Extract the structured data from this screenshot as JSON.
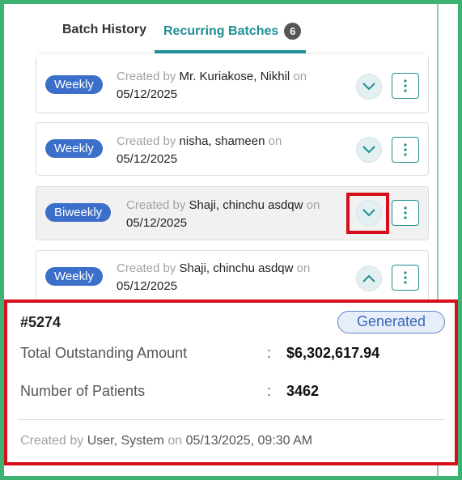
{
  "tabs": {
    "history_label": "Batch History",
    "recurring_label": "Recurring Batches",
    "recurring_count": "6"
  },
  "batches": [
    {
      "frequency": "Weekly",
      "created_by_prefix": "Created by",
      "creator": "Mr. Kuriakose, Nikhil",
      "on_text": "on",
      "date": "05/12/2025",
      "chevron_icon": "chevron-down-icon"
    },
    {
      "frequency": "Weekly",
      "created_by_prefix": "Created by",
      "creator": "nisha, shameen",
      "on_text": "on",
      "date": "05/12/2025",
      "chevron_icon": "chevron-down-icon"
    },
    {
      "frequency": "Biweekly",
      "created_by_prefix": "Created by",
      "creator": "Shaji, chinchu asdqw",
      "on_text": "on",
      "date": "05/12/2025",
      "chevron_icon": "chevron-down-icon"
    },
    {
      "frequency": "Weekly",
      "created_by_prefix": "Created by",
      "creator": "Shaji, chinchu asdqw",
      "on_text": "on",
      "date": "05/12/2025",
      "chevron_icon": "chevron-up-icon"
    }
  ],
  "detail": {
    "id": "#5274",
    "status": "Generated",
    "outstanding_label": "Total Outstanding Amount",
    "outstanding_value": "$6,302,617.94",
    "patients_label": "Number of Patients",
    "patients_value": "3462",
    "separator": ":",
    "created_by_prefix": "Created by",
    "creator": "User, System",
    "on_text": "on",
    "created_at": "05/13/2025, 09:30 AM"
  },
  "colors": {
    "frame": "#3cb371",
    "accent_teal": "#1e8f93",
    "pill_blue": "#3c6fc9",
    "highlight_red": "#d40f1b"
  }
}
